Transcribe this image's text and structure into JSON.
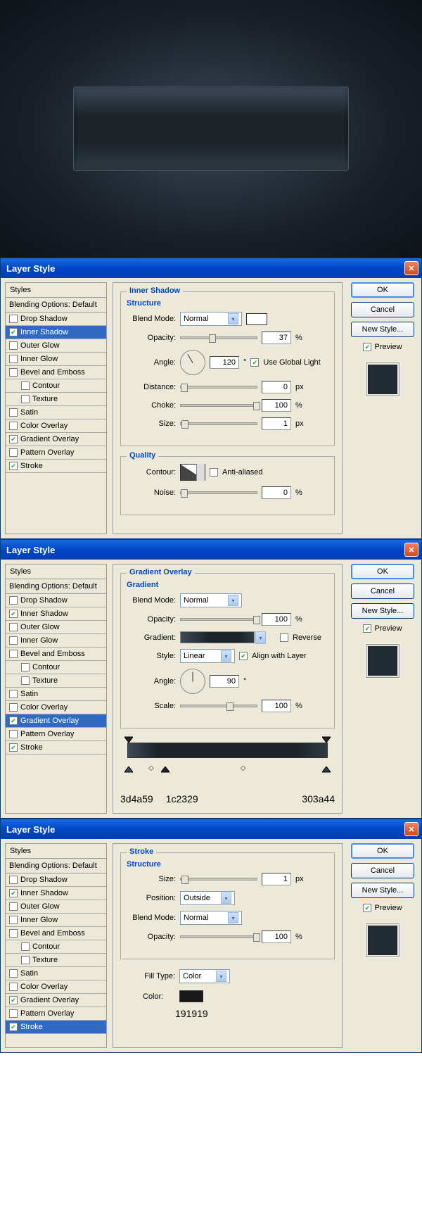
{
  "preview": {},
  "dialog1": {
    "title": "Layer Style",
    "styles_header": "Styles",
    "blending": "Blending Options: Default",
    "styles": [
      {
        "label": "Drop Shadow",
        "checked": false,
        "selected": false
      },
      {
        "label": "Inner Shadow",
        "checked": true,
        "selected": true
      },
      {
        "label": "Outer Glow",
        "checked": false,
        "selected": false
      },
      {
        "label": "Inner Glow",
        "checked": false,
        "selected": false
      },
      {
        "label": "Bevel and Emboss",
        "checked": false,
        "selected": false
      },
      {
        "label": "Contour",
        "checked": false,
        "selected": false,
        "indent": true
      },
      {
        "label": "Texture",
        "checked": false,
        "selected": false,
        "indent": true
      },
      {
        "label": "Satin",
        "checked": false,
        "selected": false
      },
      {
        "label": "Color Overlay",
        "checked": false,
        "selected": false
      },
      {
        "label": "Gradient Overlay",
        "checked": true,
        "selected": false
      },
      {
        "label": "Pattern Overlay",
        "checked": false,
        "selected": false
      },
      {
        "label": "Stroke",
        "checked": true,
        "selected": false
      }
    ],
    "panel_title": "Inner Shadow",
    "structure_title": "Structure",
    "blend_mode_label": "Blend Mode:",
    "blend_mode_value": "Normal",
    "opacity_label": "Opacity:",
    "opacity_value": "37",
    "opacity_unit": "%",
    "angle_label": "Angle:",
    "angle_value": "120",
    "angle_unit": "°",
    "global_light_label": "Use Global Light",
    "distance_label": "Distance:",
    "distance_value": "0",
    "distance_unit": "px",
    "choke_label": "Choke:",
    "choke_value": "100",
    "choke_unit": "%",
    "size_label": "Size:",
    "size_value": "1",
    "size_unit": "px",
    "quality_title": "Quality",
    "contour_label": "Contour:",
    "antialias_label": "Anti-aliased",
    "noise_label": "Noise:",
    "noise_value": "0",
    "noise_unit": "%",
    "ok": "OK",
    "cancel": "Cancel",
    "new_style": "New Style...",
    "preview_label": "Preview"
  },
  "dialog2": {
    "title": "Layer Style",
    "styles_header": "Styles",
    "blending": "Blending Options: Default",
    "styles": [
      {
        "label": "Drop Shadow",
        "checked": false,
        "selected": false
      },
      {
        "label": "Inner Shadow",
        "checked": true,
        "selected": false
      },
      {
        "label": "Outer Glow",
        "checked": false,
        "selected": false
      },
      {
        "label": "Inner Glow",
        "checked": false,
        "selected": false
      },
      {
        "label": "Bevel and Emboss",
        "checked": false,
        "selected": false
      },
      {
        "label": "Contour",
        "checked": false,
        "selected": false,
        "indent": true
      },
      {
        "label": "Texture",
        "checked": false,
        "selected": false,
        "indent": true
      },
      {
        "label": "Satin",
        "checked": false,
        "selected": false
      },
      {
        "label": "Color Overlay",
        "checked": false,
        "selected": false
      },
      {
        "label": "Gradient Overlay",
        "checked": true,
        "selected": true
      },
      {
        "label": "Pattern Overlay",
        "checked": false,
        "selected": false
      },
      {
        "label": "Stroke",
        "checked": true,
        "selected": false
      }
    ],
    "panel_title": "Gradient Overlay",
    "gradient_title": "Gradient",
    "blend_mode_label": "Blend Mode:",
    "blend_mode_value": "Normal",
    "opacity_label": "Opacity:",
    "opacity_value": "100",
    "opacity_unit": "%",
    "gradient_label": "Gradient:",
    "reverse_label": "Reverse",
    "style_label": "Style:",
    "style_value": "Linear",
    "align_label": "Align with Layer",
    "angle_label": "Angle:",
    "angle_value": "90",
    "angle_unit": "°",
    "scale_label": "Scale:",
    "scale_value": "100",
    "scale_unit": "%",
    "grad_stops": {
      "c1": "3d4a59",
      "c2": "1c2329",
      "c3": "303a44"
    },
    "ok": "OK",
    "cancel": "Cancel",
    "new_style": "New Style...",
    "preview_label": "Preview"
  },
  "dialog3": {
    "title": "Layer Style",
    "styles_header": "Styles",
    "blending": "Blending Options: Default",
    "styles": [
      {
        "label": "Drop Shadow",
        "checked": false,
        "selected": false
      },
      {
        "label": "Inner Shadow",
        "checked": true,
        "selected": false
      },
      {
        "label": "Outer Glow",
        "checked": false,
        "selected": false
      },
      {
        "label": "Inner Glow",
        "checked": false,
        "selected": false
      },
      {
        "label": "Bevel and Emboss",
        "checked": false,
        "selected": false
      },
      {
        "label": "Contour",
        "checked": false,
        "selected": false,
        "indent": true
      },
      {
        "label": "Texture",
        "checked": false,
        "selected": false,
        "indent": true
      },
      {
        "label": "Satin",
        "checked": false,
        "selected": false
      },
      {
        "label": "Color Overlay",
        "checked": false,
        "selected": false
      },
      {
        "label": "Gradient Overlay",
        "checked": true,
        "selected": false
      },
      {
        "label": "Pattern Overlay",
        "checked": false,
        "selected": false
      },
      {
        "label": "Stroke",
        "checked": true,
        "selected": true
      }
    ],
    "panel_title": "Stroke",
    "structure_title": "Structure",
    "size_label": "Size:",
    "size_value": "1",
    "size_unit": "px",
    "position_label": "Position:",
    "position_value": "Outside",
    "blend_mode_label": "Blend Mode:",
    "blend_mode_value": "Normal",
    "opacity_label": "Opacity:",
    "opacity_value": "100",
    "opacity_unit": "%",
    "fill_type_label": "Fill Type:",
    "fill_type_value": "Color",
    "color_label": "Color:",
    "color_hex": "191919",
    "ok": "OK",
    "cancel": "Cancel",
    "new_style": "New Style...",
    "preview_label": "Preview"
  }
}
